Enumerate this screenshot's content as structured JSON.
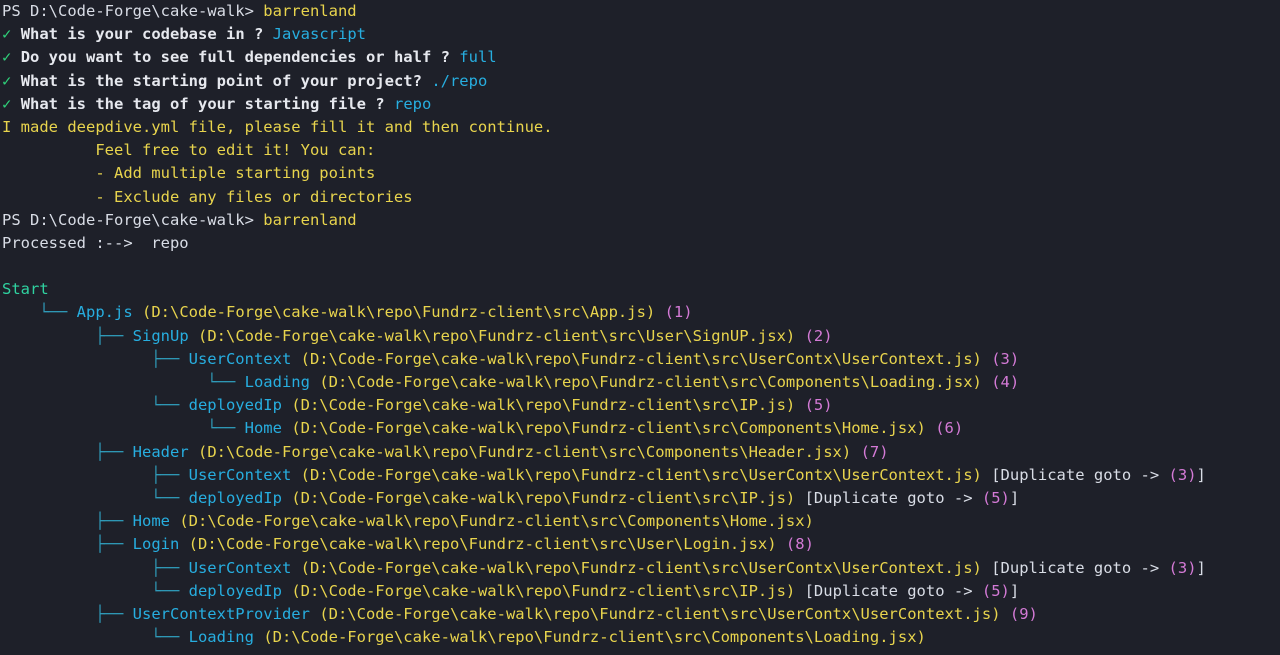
{
  "terminal": {
    "commands": [
      {
        "prompt": "PS D:\\Code-Forge\\cake-walk> ",
        "command": "barrenland"
      },
      {
        "prompt": "PS D:\\Code-Forge\\cake-walk> ",
        "command": "barrenland"
      }
    ],
    "questions": [
      {
        "check": "✓",
        "question": "What is your codebase in ?",
        "answer": "Javascript"
      },
      {
        "check": "✓",
        "question": "Do you want to see full dependencies or half ?",
        "answer": "full"
      },
      {
        "check": "✓",
        "question": "What is the starting point of your project?",
        "answer": "./repo"
      },
      {
        "check": "✓",
        "question": "What is the tag of your starting file ?",
        "answer": "repo"
      }
    ],
    "notice": {
      "main": "I made deepdive.yml file, please fill it and then continue.",
      "lines": [
        "          Feel free to edit it! You can:",
        "          - Add multiple starting points",
        "          - Exclude any files or directories"
      ]
    },
    "processed": "Processed :-->  repo",
    "start_label": "Start",
    "tree": [
      {
        "prefix": "    └── ",
        "name": "App.js",
        "path": "(D:\\Code-Forge\\cake-walk\\repo\\Fundrz-client\\src\\App.js)",
        "num": "(1)",
        "dup": ""
      },
      {
        "prefix": "          ├── ",
        "name": "SignUp",
        "path": "(D:\\Code-Forge\\cake-walk\\repo\\Fundrz-client\\src\\User\\SignUP.jsx)",
        "num": "(2)",
        "dup": ""
      },
      {
        "prefix": "                ├── ",
        "name": "UserContext",
        "path": "(D:\\Code-Forge\\cake-walk\\repo\\Fundrz-client\\src\\UserContx\\UserContext.js)",
        "num": "(3)",
        "dup": ""
      },
      {
        "prefix": "                      └── ",
        "name": "Loading",
        "path": "(D:\\Code-Forge\\cake-walk\\repo\\Fundrz-client\\src\\Components\\Loading.jsx)",
        "num": "(4)",
        "dup": ""
      },
      {
        "prefix": "                └── ",
        "name": "deployedIp",
        "path": "(D:\\Code-Forge\\cake-walk\\repo\\Fundrz-client\\src\\IP.js)",
        "num": "(5)",
        "dup": ""
      },
      {
        "prefix": "                      └── ",
        "name": "Home",
        "path": "(D:\\Code-Forge\\cake-walk\\repo\\Fundrz-client\\src\\Components\\Home.jsx)",
        "num": "(6)",
        "dup": ""
      },
      {
        "prefix": "          ├── ",
        "name": "Header",
        "path": "(D:\\Code-Forge\\cake-walk\\repo\\Fundrz-client\\src\\Components\\Header.jsx)",
        "num": "(7)",
        "dup": ""
      },
      {
        "prefix": "                ├── ",
        "name": "UserContext",
        "path": "(D:\\Code-Forge\\cake-walk\\repo\\Fundrz-client\\src\\UserContx\\UserContext.js)",
        "num": "",
        "dup": "[Duplicate goto -> ",
        "dupnum": "(3)",
        "dupend": "]"
      },
      {
        "prefix": "                └── ",
        "name": "deployedIp",
        "path": "(D:\\Code-Forge\\cake-walk\\repo\\Fundrz-client\\src\\IP.js)",
        "num": "",
        "dup": "[Duplicate goto -> ",
        "dupnum": "(5)",
        "dupend": "]"
      },
      {
        "prefix": "          ├── ",
        "name": "Home",
        "path": "(D:\\Code-Forge\\cake-walk\\repo\\Fundrz-client\\src\\Components\\Home.jsx)",
        "num": "",
        "dup": ""
      },
      {
        "prefix": "          ├── ",
        "name": "Login",
        "path": "(D:\\Code-Forge\\cake-walk\\repo\\Fundrz-client\\src\\User\\Login.jsx)",
        "num": "(8)",
        "dup": ""
      },
      {
        "prefix": "                ├── ",
        "name": "UserContext",
        "path": "(D:\\Code-Forge\\cake-walk\\repo\\Fundrz-client\\src\\UserContx\\UserContext.js)",
        "num": "",
        "dup": "[Duplicate goto -> ",
        "dupnum": "(3)",
        "dupend": "]"
      },
      {
        "prefix": "                └── ",
        "name": "deployedIp",
        "path": "(D:\\Code-Forge\\cake-walk\\repo\\Fundrz-client\\src\\IP.js)",
        "num": "",
        "dup": "[Duplicate goto -> ",
        "dupnum": "(5)",
        "dupend": "]"
      },
      {
        "prefix": "          ├── ",
        "name": "UserContextProvider",
        "path": "(D:\\Code-Forge\\cake-walk\\repo\\Fundrz-client\\src\\UserContx\\UserContext.js)",
        "num": "(9)",
        "dup": ""
      },
      {
        "prefix": "                └── ",
        "name": "Loading",
        "path": "(D:\\Code-Forge\\cake-walk\\repo\\Fundrz-client\\src\\Components\\Loading.jsx)",
        "num": "",
        "dup": ""
      }
    ],
    "colors": {
      "background": "#1e2029",
      "command": "#e8d44d",
      "check": "#2fd27a",
      "answer": "#27aee0",
      "path": "#e8d44d",
      "number": "#d47ad6",
      "start": "#2fd2a0"
    }
  }
}
